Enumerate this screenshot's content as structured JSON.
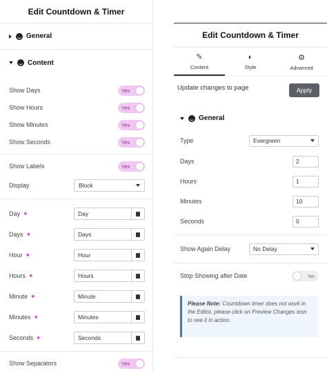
{
  "left": {
    "title": "Edit Countdown & Timer",
    "sections": {
      "general": "General",
      "content": "Content"
    },
    "toggles": [
      {
        "label": "Show Days",
        "value": "Yes"
      },
      {
        "label": "Show Hours",
        "value": "Yes"
      },
      {
        "label": "Show Minutes",
        "value": "Yes"
      },
      {
        "label": "Show Seconds",
        "value": "Yes"
      },
      {
        "label": "Show Labels",
        "value": "Yes"
      }
    ],
    "display": {
      "label": "Display",
      "value": "Block"
    },
    "labels": [
      {
        "label": "Day",
        "value": "Day"
      },
      {
        "label": "Days",
        "value": "Days"
      },
      {
        "label": "Hour",
        "value": "Hour"
      },
      {
        "label": "Hours",
        "value": "Hours"
      },
      {
        "label": "Minute",
        "value": "Minute"
      },
      {
        "label": "Minutes",
        "value": "Minutes"
      },
      {
        "label": "Seconds",
        "value": "Seconds"
      }
    ],
    "separators": {
      "label": "Show Separators",
      "value": "Yes"
    }
  },
  "right": {
    "title": "Edit Countdown & Timer",
    "tabs": [
      {
        "label": "Content",
        "icon": "pencil-icon"
      },
      {
        "label": "Style",
        "icon": "contrast-icon"
      },
      {
        "label": "Advanced",
        "icon": "gear-icon"
      }
    ],
    "update_text": "Update changes to page",
    "apply_label": "Apply",
    "section": "General",
    "type": {
      "label": "Type",
      "value": "Evergreen"
    },
    "fields": [
      {
        "label": "Days",
        "value": "2"
      },
      {
        "label": "Hours",
        "value": "1"
      },
      {
        "label": "Minutes",
        "value": "10"
      },
      {
        "label": "Seconds",
        "value": "0"
      }
    ],
    "show_again": {
      "label": "Show Again Delay",
      "value": "No Delay"
    },
    "stop_showing": {
      "label": "Stop Showing after Date",
      "value": "No"
    },
    "note": {
      "bold": "Please Note:",
      "text": " Countdown timer does not work in the Editor, please click on Preview Changes icon to see it in action."
    }
  },
  "colors": {
    "toggle_on": "#f2c8f2",
    "apply_button": "#5d6165",
    "note_border": "#3a78c3",
    "sparkle": "#c93bd8"
  }
}
